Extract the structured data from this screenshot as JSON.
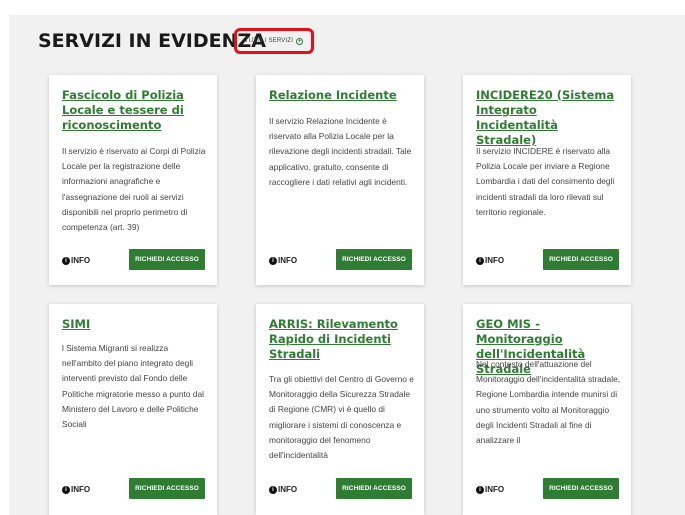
{
  "section": {
    "title": "SERVIZI IN EVIDENZA",
    "all_services_label": "TUTTI I SERVIZI",
    "all_services_icon": "plus-circle-icon",
    "highlight_color": "#e3101a"
  },
  "colors": {
    "accent": "#2e7d32",
    "panel_bg": "#f1f1f1"
  },
  "cards": [
    {
      "title": "Fascicolo di Polizia Locale e tessere di riconoscimento",
      "description": "Il servizio è riservato ai Corpi di Polizia Locale per la registrazione delle informazioni anagrafiche e l'assegnazione dei ruoli ai servizi disponibili nel proprio perimetro di competenza (art. 39)",
      "info_label": "INFO",
      "button_label": "RICHIEDI ACCESSO"
    },
    {
      "title": "Relazione Incidente",
      "description": "Il servizio Relazione Incidente è riservato alla Polizia Locale per la rilevazione degli incidenti stradali. Tale applicativo, gratuito, consente di raccogliere i dati relativi agli incidenti.",
      "info_label": "INFO",
      "button_label": "RICHIEDI ACCESSO"
    },
    {
      "title": "INCIDERE20 (Sistema Integrato Incidentalità Stradale)",
      "description": "Il servizio INCIDERE è riservato alla Polizia Locale per inviare a Regione Lombardia i dati del consimento degli incidenti stradali da loro rilevati sul territorio regionale.",
      "info_label": "INFO",
      "button_label": "RICHIEDI ACCESSO"
    },
    {
      "title": "SIMI",
      "description": "l Sistema Migranti si realizza nell'ambito del piano integrato degli interventi previsto dal Fondo delle Politiche migratorie messo a punto dal Ministero del Lavoro e delle Politiche Sociali",
      "info_label": "INFO",
      "button_label": "RICHIEDI ACCESSO"
    },
    {
      "title": "ARRIS: Rilevamento Rapido di Incidenti Stradali",
      "description": "Tra gli obiettivi del Centro di Governo e Monitoraggio della Sicurezza Stradale di Regione (CMR) vi è quello di migliorare i sistemi di conoscenza e monitoraggio del fenomeno dell'incidentalità",
      "info_label": "INFO",
      "button_label": "RICHIEDI ACCESSO"
    },
    {
      "title": "GEO MIS - Monitoraggio dell'Incidentalità Stradale",
      "description": "Nel contesto dell'attuazione del Monitoraggio dell'incidentalità stradale, Regione Lombardia intende munirsi di uno strumento volto al Monitoraggio degli Incidenti Stradali al fine di analizzare il",
      "info_label": "INFO",
      "button_label": "RICHIEDI ACCESSO"
    }
  ]
}
